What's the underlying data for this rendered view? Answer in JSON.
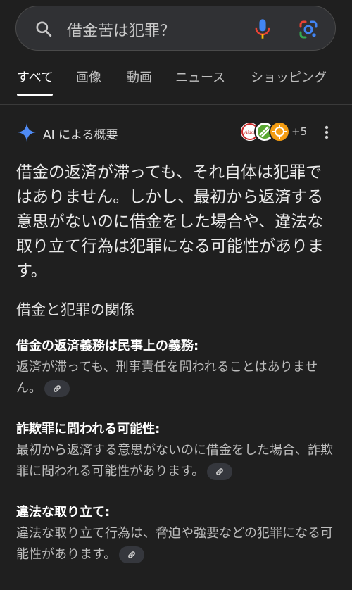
{
  "search": {
    "query": "借金苦は犯罪？"
  },
  "tabs": [
    {
      "label": "すべて"
    },
    {
      "label": "画像"
    },
    {
      "label": "動画"
    },
    {
      "label": "ニュース"
    },
    {
      "label": "ショッピング"
    }
  ],
  "ai_overview": {
    "title": "AI による概要",
    "more_sources": "+5",
    "summary": "借金の返済が滞っても、それ自体は犯罪ではありません。しかし、最初から返済する意思がないのに借金をした場合や、違法な取り立て行為は犯罪になる可能性があります。",
    "section_title": "借金と犯罪の関係",
    "points": [
      {
        "heading": "借金の返済義務は民事上の義務:",
        "body": "返済が滞っても、刑事責任を問われることはありません。"
      },
      {
        "heading": "詐欺罪に問われる可能性:",
        "body": "最初から返済する意思がないのに借金をした場合、詐欺罪に問われる可能性があります。"
      },
      {
        "heading": "違法な取り立て:",
        "body": "違法な取り立て行為は、脅迫や強要などの犯罪になる可能性があります。"
      }
    ],
    "avatar_logo_text": "Aidor"
  },
  "colors": {
    "background": "#1f1f1f",
    "sparkle": "#4f8bf5",
    "mic": "#4285f4"
  }
}
